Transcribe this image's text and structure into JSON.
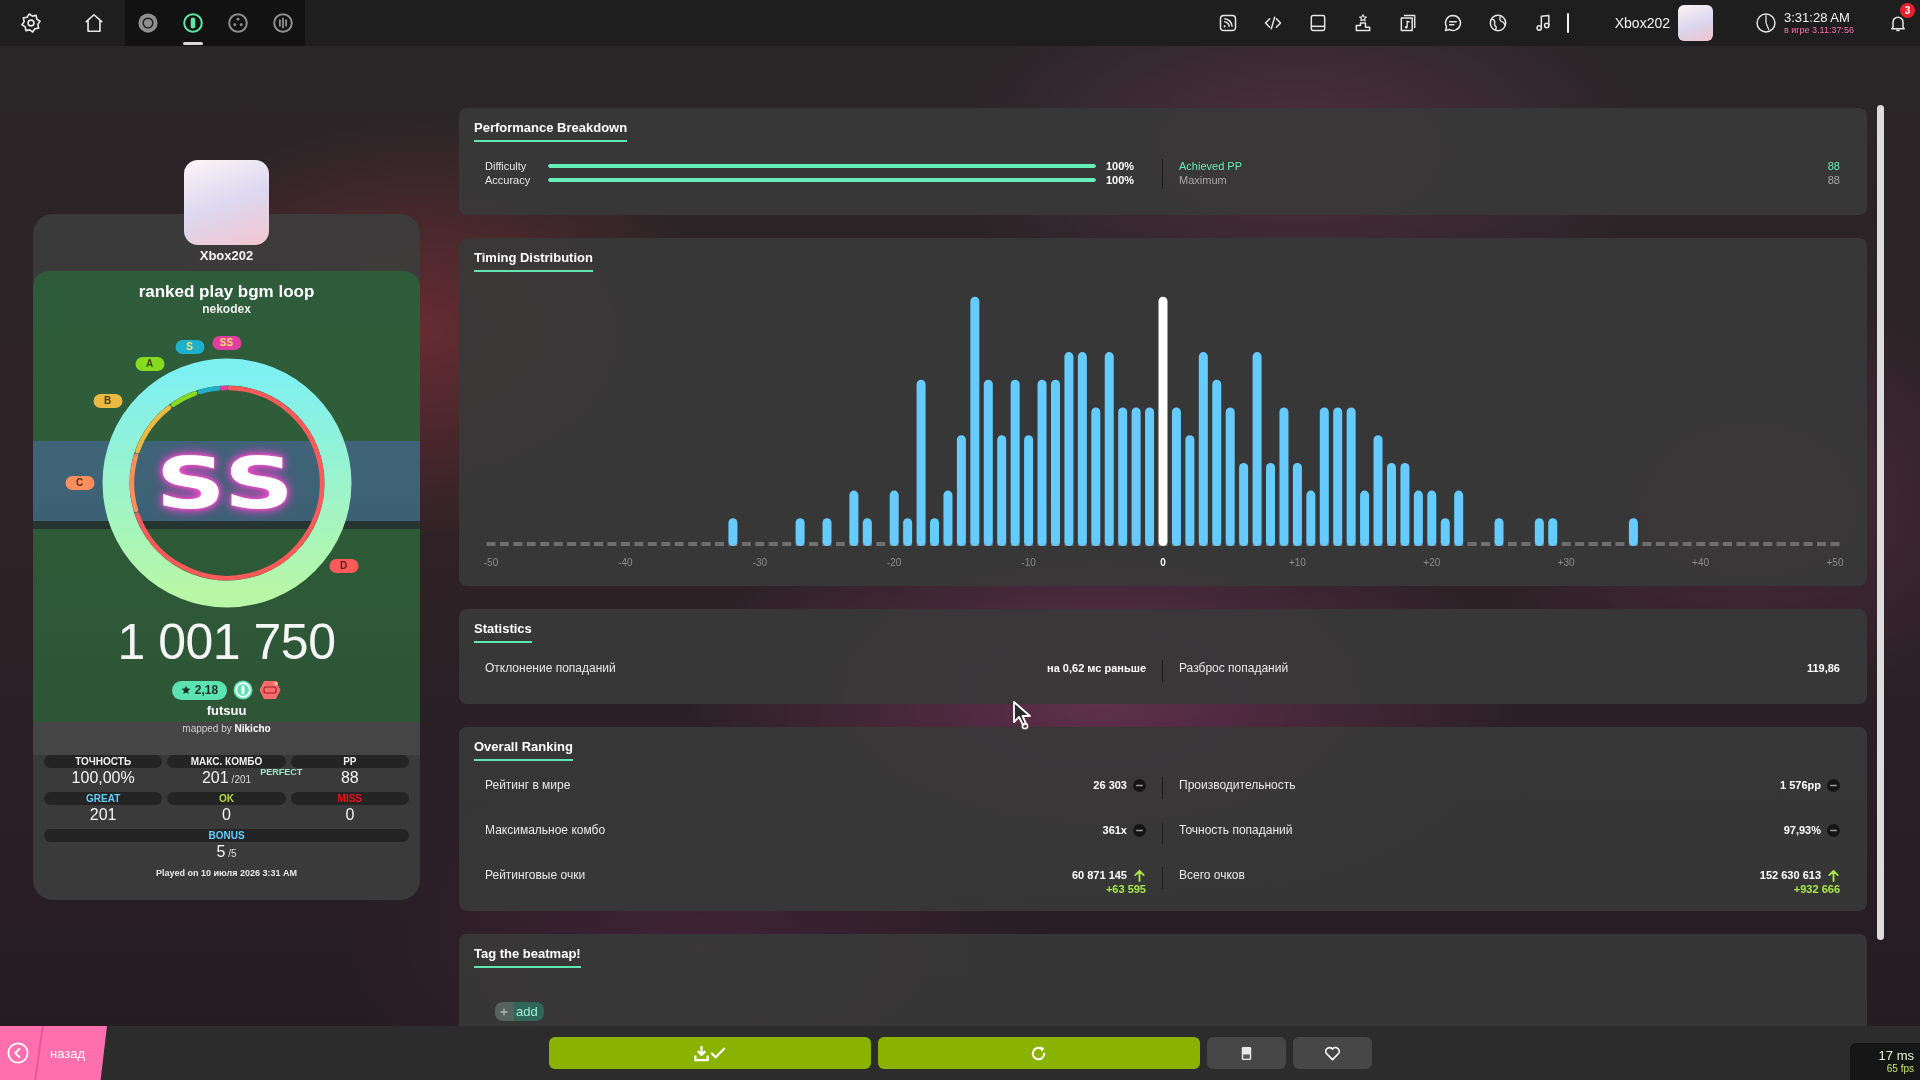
{
  "top_bar": {
    "rulesets": [
      {
        "kind": "disc",
        "selected": false
      },
      {
        "kind": "pill",
        "selected": true
      },
      {
        "kind": "dots",
        "selected": false
      },
      {
        "kind": "bars",
        "selected": false
      }
    ],
    "user": {
      "name": "Xbox202"
    },
    "clock": {
      "time": "3:31:28 AM",
      "session": "в игре 3.11:37:56"
    },
    "notifications": {
      "count": "3"
    }
  },
  "player": {
    "name": "Xbox202"
  },
  "beatmap": {
    "title": "ranked play bgm loop",
    "artist": "nekodex",
    "star_rating": "2,18",
    "difficulty": "futsuu",
    "mapper": "mapped by **Nikicho**"
  },
  "result": {
    "grade": "SS",
    "score": "1 001 750",
    "grade_badges": [
      {
        "label": "SS",
        "color": "#e03fa0",
        "highlighted": true
      },
      {
        "label": "S",
        "color": "#1fb0cc",
        "highlighted": true
      },
      {
        "label": "A",
        "color": "#88da20",
        "highlighted": false
      },
      {
        "label": "B",
        "color": "#e9b941",
        "highlighted": false
      },
      {
        "label": "C",
        "color": "#ff8e5d",
        "highlighted": false
      },
      {
        "label": "D",
        "color": "#ff5a5a",
        "highlighted": false
      }
    ]
  },
  "score_stats": [
    {
      "label": "ТОЧНОСТЬ",
      "value": "100,00%"
    },
    {
      "label": "МАКС. КОМБО",
      "value": "201",
      "max": "/201",
      "note": "PERFECT"
    },
    {
      "label": "PP",
      "value": "88"
    }
  ],
  "judgements": [
    {
      "label": "GREAT",
      "value": "201",
      "color": "#66ccff"
    },
    {
      "label": "OK",
      "value": "0",
      "color": "#b3d944"
    },
    {
      "label": "MISS",
      "value": "0",
      "color": "#ed1121"
    }
  ],
  "bonus": {
    "label": "BONUS",
    "value": "5",
    "max": "/5"
  },
  "played_on": "Played on 10 июля 2026 3:31 AM",
  "performance_breakdown": {
    "title": "Performance Breakdown",
    "bars": [
      {
        "label": "Difficulty",
        "level": 1,
        "reading": "100%"
      },
      {
        "label": "Accuracy",
        "level": 1,
        "reading": "100%"
      }
    ],
    "pp": [
      {
        "label": "Achieved PP",
        "value": "88",
        "highlighted": true
      },
      {
        "label": "Maximum",
        "value": "88",
        "highlighted": false
      }
    ]
  },
  "timing_distribution": {
    "title": "Timing Distribution",
    "axis_labels": [
      {
        "label": "-50",
        "highlighted": false
      },
      {
        "label": "-40",
        "highlighted": false
      },
      {
        "label": "-30",
        "highlighted": false
      },
      {
        "label": "-20",
        "highlighted": false
      },
      {
        "label": "-10",
        "highlighted": false
      },
      {
        "label": "0",
        "highlighted": true
      },
      {
        "label": "+10",
        "highlighted": false
      },
      {
        "label": "+20",
        "highlighted": false
      },
      {
        "label": "+30",
        "highlighted": false
      },
      {
        "label": "+40",
        "highlighted": false
      },
      {
        "label": "+50",
        "highlighted": false
      }
    ]
  },
  "statistics": {
    "title": "Statistics",
    "items": [
      {
        "label": "Отклонение попаданий",
        "value": "на 0,62 мс раньше"
      },
      {
        "label": "Разброс попаданий",
        "value": "119,86"
      }
    ]
  },
  "overall_ranking": {
    "title": "Overall Ranking",
    "items": [
      {
        "label": "Рейтинг в мире",
        "value": "26 303",
        "kind": "same"
      },
      {
        "label": "Производительность",
        "value": "1 576pp",
        "kind": "same"
      },
      {
        "label": "Максимальное комбо",
        "value": "361x",
        "kind": "same"
      },
      {
        "label": "Точность попаданий",
        "value": "97,93%",
        "kind": "same"
      },
      {
        "label": "Рейтинговые очки",
        "value": "60 871 145",
        "kind": "up",
        "change": "+63 595"
      },
      {
        "label": "Всего очков",
        "value": "152 630 613",
        "kind": "up",
        "change": "+932 666"
      }
    ]
  },
  "tag_beatmap": {
    "title": "Tag the beatmap!",
    "add_label": "add"
  },
  "bottom_bar": {
    "back_label": "назад",
    "latency": "17 ms",
    "frame_rate": "65 fps"
  }
}
